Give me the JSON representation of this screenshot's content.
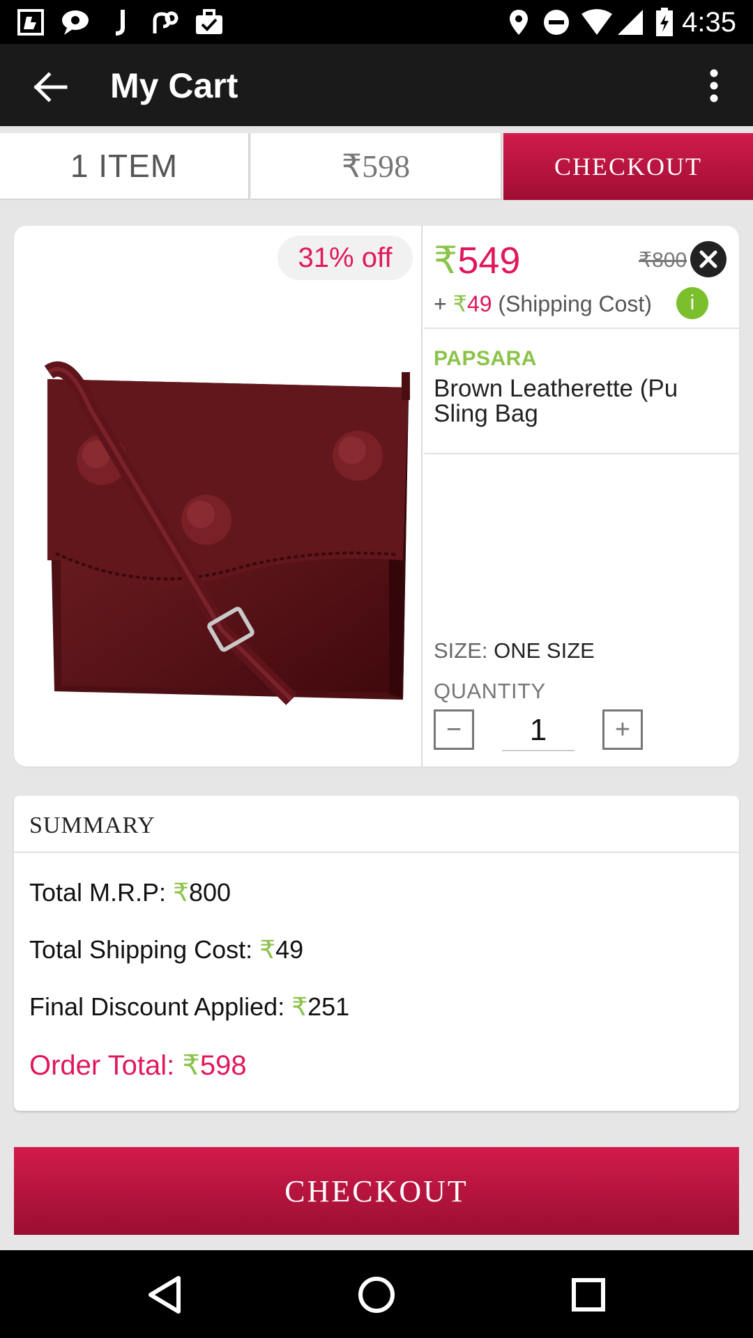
{
  "status_bar": {
    "time": "4:35",
    "left_icons": [
      "notification-app-icon",
      "message-icon",
      "j-app-icon",
      "link-app-icon",
      "briefcase-check-icon"
    ],
    "right_icons": [
      "location-icon",
      "do-not-disturb-icon",
      "wifi-icon",
      "cell-signal-icon",
      "battery-charging-icon"
    ]
  },
  "app_bar": {
    "title": "My Cart",
    "back_icon": "arrow-back-icon",
    "menu_icon": "more-vert-icon"
  },
  "summary_tabs": {
    "items": "1 ITEM",
    "total": "₹598",
    "checkout": "CHECKOUT"
  },
  "product": {
    "discount": "31% off",
    "rupee": "₹",
    "sale_price": "549",
    "mrp": "₹800",
    "shipping_prefix": "+",
    "shipping_amount": "49",
    "shipping_label": "(Shipping Cost)",
    "info_label": "i",
    "brand": "PAPSARA",
    "name": "Brown Leatherette (Pu Sling Bag",
    "size_label": "SIZE:",
    "size_value": "ONE SIZE",
    "quantity_label": "QUANTITY",
    "quantity": "1",
    "minus": "−",
    "plus": "+"
  },
  "summary": {
    "title": "SUMMARY",
    "rupee": "₹",
    "mrp_label": "Total M.R.P:",
    "mrp_value": "800",
    "shipping_label": "Total Shipping Cost:",
    "shipping_value": "49",
    "discount_label": "Final Discount Applied:",
    "discount_value": "251",
    "order_total_label": "Order Total:",
    "order_total_value": "598"
  },
  "checkout_button": "CHECKOUT",
  "colors": {
    "accent": "#d21b4c",
    "price_pink": "#e0185a",
    "rupee_green": "#8bc34a",
    "app_bar": "#1a1a1a"
  }
}
